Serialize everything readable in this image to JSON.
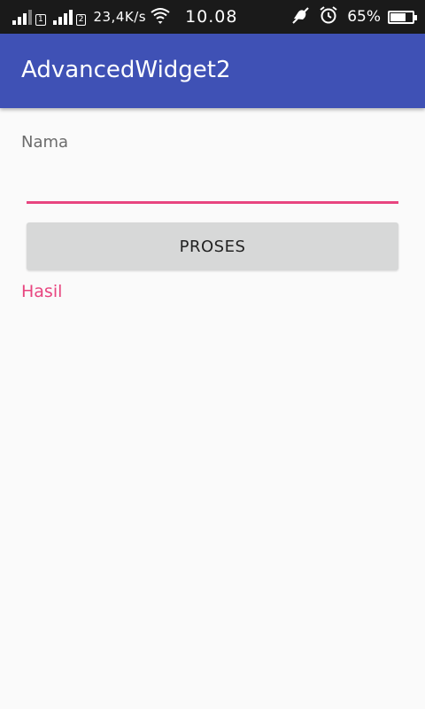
{
  "status_bar": {
    "network_speed": "23,4K/s",
    "time": "10.08",
    "battery_percent": "65%",
    "battery_level": 0.65,
    "sim1_label": "1",
    "sim2_label": "2",
    "icons": [
      "signal-icon",
      "wifi-icon",
      "mute-icon",
      "alarm-icon",
      "battery-icon"
    ]
  },
  "app_bar": {
    "title": "AdvancedWidget2",
    "color": "#3f51b5"
  },
  "form": {
    "name_label": "Nama",
    "name_value": "",
    "process_button_label": "PROSES",
    "result_label": "Hasil",
    "accent_color": "#e8457f"
  }
}
